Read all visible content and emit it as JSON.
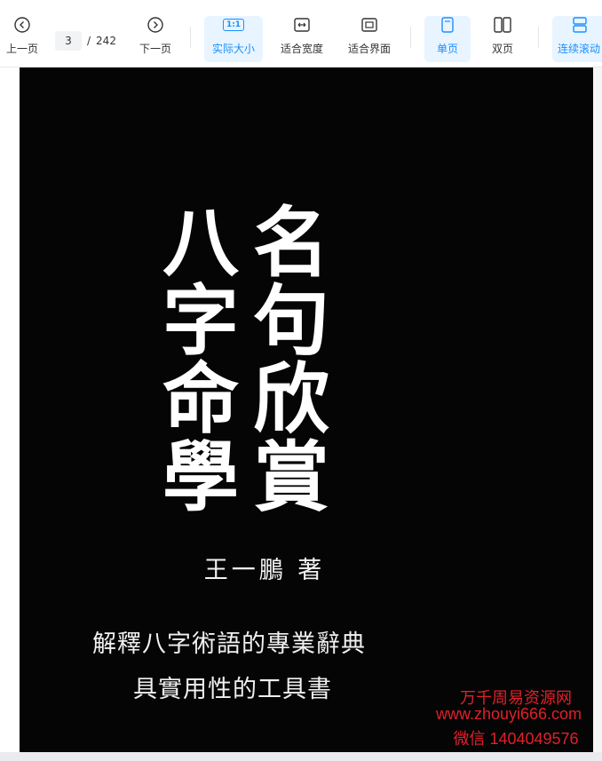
{
  "toolbar": {
    "prev_label": "上一页",
    "next_label": "下一页",
    "current_page": "3",
    "page_separator": "/",
    "total_pages": "242",
    "actual_size_label": "实际大小",
    "actual_size_icon_text": "1:1",
    "fit_width_label": "适合宽度",
    "fit_page_label": "适合界面",
    "single_page_label": "单页",
    "double_page_label": "双页",
    "continuous_label": "连续滚动",
    "accent_color": "#1890ff"
  },
  "document": {
    "title_right_column": [
      "名",
      "句",
      "欣",
      "賞"
    ],
    "title_left_column": [
      "八",
      "字",
      "命",
      "學"
    ],
    "author": "王一鵬 著",
    "subtitle_line1": "解釋八字術語的專業辭典",
    "subtitle_line2": "具實用性的工具書"
  },
  "watermark": {
    "line1": "万千周易资源网",
    "line2": "www.zhouyi666.com",
    "line3": "微信 1404049576",
    "color": "#e0202a"
  }
}
